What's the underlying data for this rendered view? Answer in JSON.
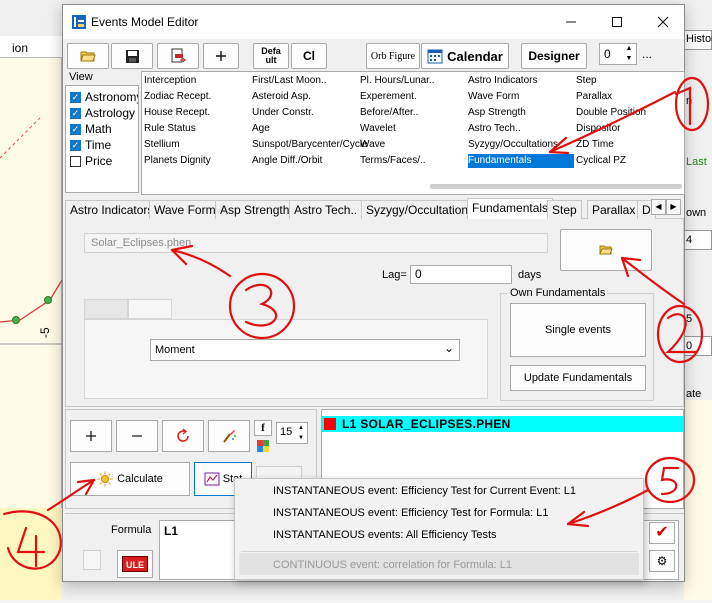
{
  "window": {
    "title": "Events Model Editor"
  },
  "toolbar": {
    "default_label_line1": "Defa",
    "default_label_line2": "ult",
    "cl_label": "Cl",
    "orb_figure_label": "Orb Figure",
    "calendar_label": "Calendar",
    "designer_label": "Designer",
    "spin_value": "0",
    "more_label": "..."
  },
  "view": {
    "label": "View",
    "items": [
      {
        "label": "Astronomy",
        "checked": true
      },
      {
        "label": "Astrology",
        "checked": true
      },
      {
        "label": "Math",
        "checked": true
      },
      {
        "label": "Time",
        "checked": true
      },
      {
        "label": "Price",
        "checked": false
      }
    ]
  },
  "grid": {
    "columns": [
      [
        "Interception",
        "Zodiac Recept.",
        "House Recept.",
        "Rule Status",
        "Stellium",
        "Planets Dignity"
      ],
      [
        "First/Last Moon..",
        "Asteroid Asp.",
        "Under Constr.",
        "Age",
        "Sunspot/Barycenter/Cycle",
        "Angle Diff./Orbit"
      ],
      [
        "Pl. Hours/Lunar..",
        "Experement.",
        "Before/After..",
        "Wavelet",
        "Wave",
        "Terms/Faces/.."
      ],
      [
        "Astro Indicators",
        "Wave Form",
        "Asp Strength",
        "Astro Tech..",
        "Syzygy/Occultations",
        "Fundamentals"
      ],
      [
        "Step",
        "Parallax",
        "Double Position",
        "Dispositor",
        "ZD Time",
        "Cyclical PZ"
      ]
    ],
    "selected": "Fundamentals"
  },
  "tabs": [
    "Astro Indicators",
    "Wave Form",
    "Asp Strength",
    "Astro Tech..",
    "Syzygy/Occultations",
    "Fundamentals",
    "Step",
    "Parallax",
    "D"
  ],
  "active_tab": "Fundamentals",
  "fundamentals": {
    "file_name": "Solar_Eclipses.phen",
    "lag_label": "Lag=",
    "lag_value": "0",
    "lag_unit": "days",
    "own_fundamentals_label": "Own Fundamentals",
    "single_events_label": "Single events",
    "update_label": "Update Fundamentals",
    "moment_value": "Moment"
  },
  "lower": {
    "font_size": "15",
    "calculate_label": "Calculate",
    "stat_label": "Stat",
    "result_line": "L1   SOLAR_ECLIPSES.PHEN"
  },
  "formula": {
    "label": "Formula",
    "value": "L1",
    "rule_label": "ULE"
  },
  "menu": {
    "items": [
      {
        "label": "INSTANTANEOUS event: Efficiency Test for Current Event: L1",
        "enabled": true
      },
      {
        "label": "INSTANTANEOUS event: Efficiency Test for Formula: L1",
        "enabled": true
      },
      {
        "label": "INSTANTANEOUS events: All  Efficiency Tests",
        "enabled": true
      },
      {
        "label": "CONTINUOUS event: correlation for Formula: L1",
        "enabled": false
      }
    ]
  },
  "background": {
    "left_title": "ion",
    "axis_label": "-5",
    "right_texts": [
      "Histor",
      "n",
      "Last",
      "own",
      "4",
      "5",
      "0",
      "ate"
    ]
  },
  "annotations": [
    "1",
    "2",
    "3",
    "4",
    "5"
  ],
  "colors": {
    "accent": "#0078d7",
    "selection": "#0078d7",
    "result_bar": "#00ffff",
    "annotation": "#e01010"
  }
}
